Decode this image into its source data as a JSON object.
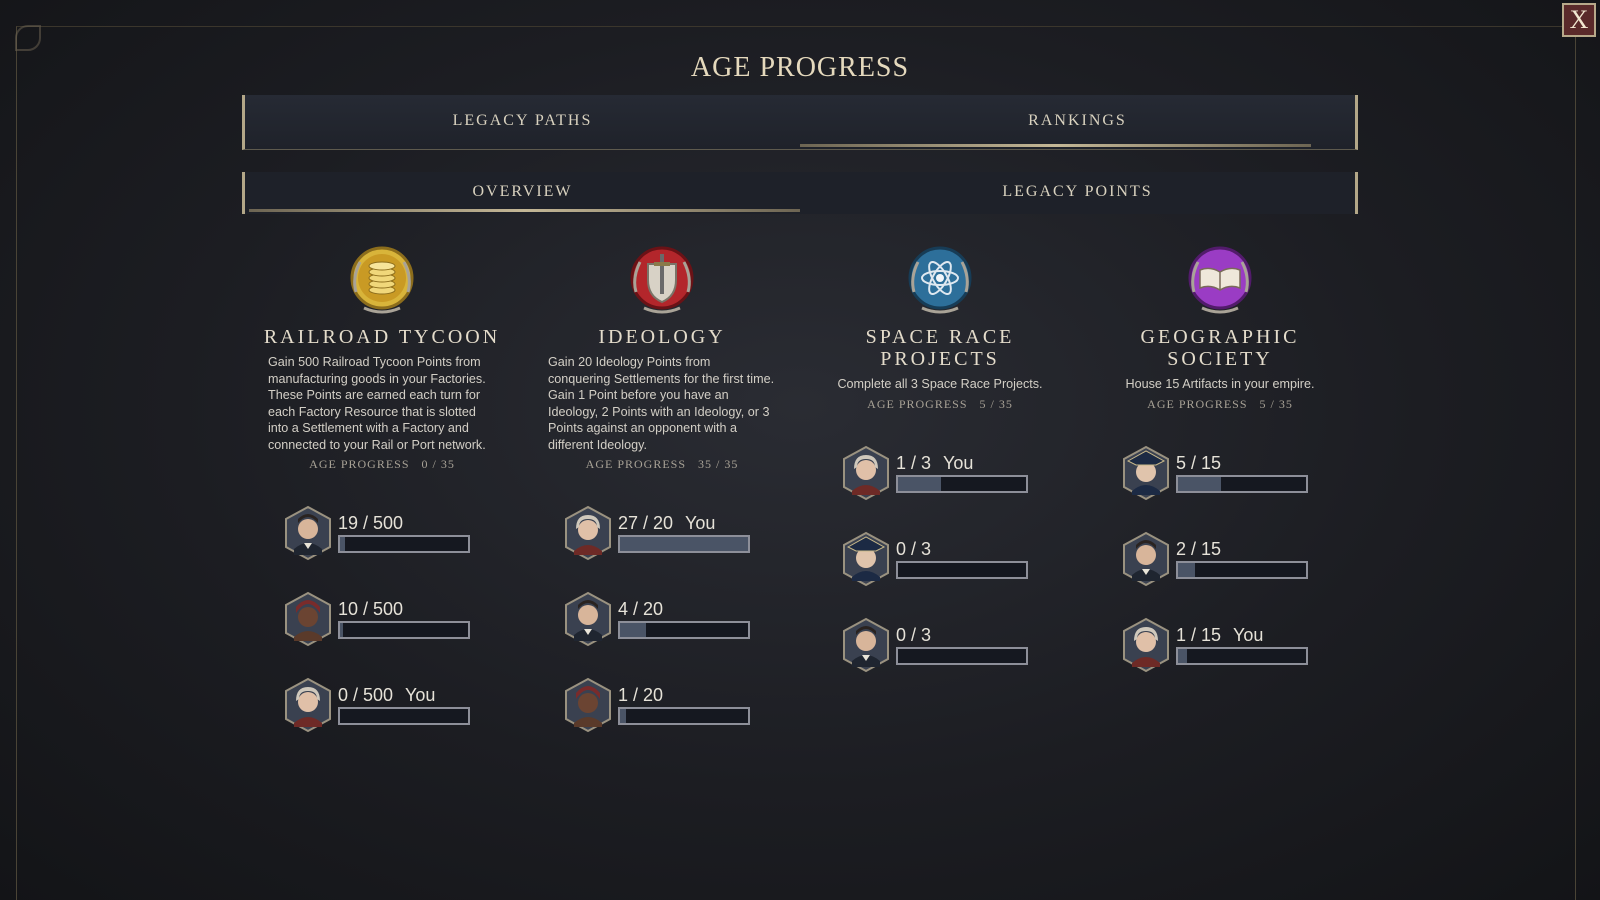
{
  "close_label": "X",
  "title": "AGE PROGRESS",
  "main_tabs": [
    {
      "label": "LEGACY PATHS",
      "active": false
    },
    {
      "label": "RANKINGS",
      "active": true
    }
  ],
  "sub_tabs": [
    {
      "label": "OVERVIEW",
      "active": true
    },
    {
      "label": "LEGACY POINTS",
      "active": false
    }
  ],
  "colors": {
    "gold": "#d8b43a",
    "red": "#b3262b",
    "blue": "#3a86b8",
    "purple": "#9a3cc4",
    "bar_fill": "#4a5466"
  },
  "legacy_paths": [
    {
      "icon": "coin-stack-icon",
      "title": "RAILROAD TYCOON",
      "description": "Gain 500 Railroad Tycoon Points from manufacturing goods in your Factories. These Points are earned each turn for each Factory Resource that is slotted into a Settlement with a Factory and connected to your Rail or Port network.",
      "age_progress": "AGE PROGRESS   0 / 35",
      "rankings": [
        {
          "leader": "leader-portrait-man",
          "text": "19 / 500",
          "you": "",
          "progress": 0.038
        },
        {
          "leader": "leader-portrait-woman-headwrap",
          "text": "10 / 500",
          "you": "",
          "progress": 0.02
        },
        {
          "leader": "leader-portrait-elder",
          "text": "0 / 500",
          "you": "You",
          "progress": 0.0
        }
      ]
    },
    {
      "icon": "shield-sword-icon",
      "title": "IDEOLOGY",
      "description": "Gain 20 Ideology Points from conquering Settlements for the first time. Gain 1 Point before you have an Ideology, 2 Points with an Ideology, or 3 Points against an opponent with a different Ideology.",
      "age_progress": "AGE PROGRESS   35 / 35",
      "rankings": [
        {
          "leader": "leader-portrait-elder",
          "text": "27 / 20",
          "you": "You",
          "progress": 1.0
        },
        {
          "leader": "leader-portrait-man",
          "text": "4 / 20",
          "you": "",
          "progress": 0.2
        },
        {
          "leader": "leader-portrait-woman-headwrap",
          "text": "1 / 20",
          "you": "",
          "progress": 0.05
        }
      ]
    },
    {
      "icon": "atom-icon",
      "title": "SPACE RACE PROJECTS",
      "description": "Complete all 3 Space Race Projects.",
      "age_progress": "AGE PROGRESS   5 / 35",
      "rankings": [
        {
          "leader": "leader-portrait-elder",
          "text": "1 / 3",
          "you": "You",
          "progress": 0.333
        },
        {
          "leader": "leader-portrait-tricorn",
          "text": "0 / 3",
          "you": "",
          "progress": 0.0
        },
        {
          "leader": "leader-portrait-man",
          "text": "0 / 3",
          "you": "",
          "progress": 0.0
        }
      ]
    },
    {
      "icon": "open-book-icon",
      "title": "GEOGRAPHIC SOCIETY",
      "description": "House 15 Artifacts in your empire.",
      "age_progress": "AGE PROGRESS   5 / 35",
      "rankings": [
        {
          "leader": "leader-portrait-tricorn",
          "text": "5 / 15",
          "you": "",
          "progress": 0.333
        },
        {
          "leader": "leader-portrait-man",
          "text": "2 / 15",
          "you": "",
          "progress": 0.133
        },
        {
          "leader": "leader-portrait-elder",
          "text": "1 / 15",
          "you": "You",
          "progress": 0.067
        }
      ]
    }
  ]
}
